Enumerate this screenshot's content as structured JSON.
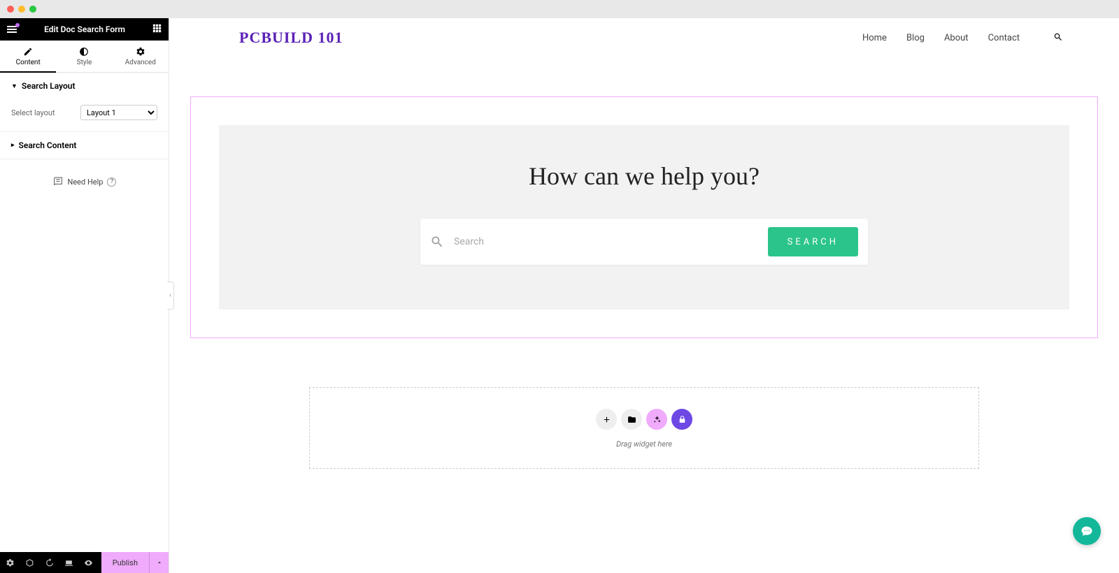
{
  "panel": {
    "title": "Edit Doc Search Form",
    "tabs": {
      "content": "Content",
      "style": "Style",
      "advanced": "Advanced"
    },
    "sections": {
      "search_layout": {
        "title": "Search Layout",
        "select_label": "Select layout",
        "select_value": "Layout 1"
      },
      "search_content": {
        "title": "Search Content"
      }
    },
    "need_help": "Need Help",
    "publish": "Publish"
  },
  "site": {
    "logo": "PCBUILD 101",
    "nav": {
      "home": "Home",
      "blog": "Blog",
      "about": "About",
      "contact": "Contact"
    }
  },
  "widget": {
    "title": "How can we help you?",
    "placeholder": "Search",
    "button": "SEARCH"
  },
  "dropzone": {
    "hint": "Drag widget here"
  }
}
